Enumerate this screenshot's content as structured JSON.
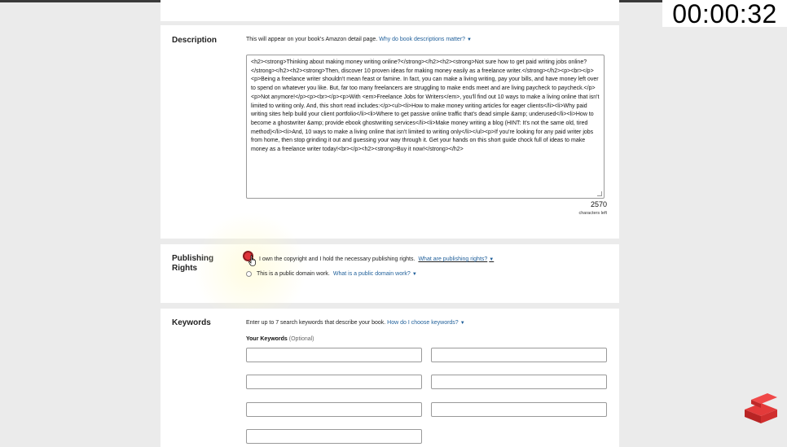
{
  "timer": "00:00:32",
  "description": {
    "title": "Description",
    "help_text": "This will appear on your book's Amazon detail page.",
    "help_link": "Why do book descriptions matter?",
    "content": "<h2><strong>Thinking about making money writing online?</strong></h2><h2><strong>Not sure how to get paid writing jobs online?</strong></h2><h2><strong>Then, discover 10 proven ideas for making money easily as a freelance writer.</strong></h2><p><br></p><p>Being a freelance writer shouldn't mean feast or famine. In fact, you can make a living writing, pay your bills, and have money left over to spend on whatever you like. But, far too many freelancers are struggling to make ends meet and are living paycheck to paycheck.</p><p>Not anymore!</p><p><br></p><p>With <em>Freelance Jobs for Writers</em>, you'll find out 10 ways to make a living online that isn't limited to writing only. And, this short read includes:</p><ul><li>How to make money writing articles for eager clients</li><li>Why paid writing sites help build your client portfolio</li><li>Where to get passive online traffic that's dead simple &amp; underused</li><li>How to become a ghostwriter &amp; provide ebook ghostwriting services</li><li>Make money writing a blog (HINT: It's not the same old, tired method)</li><li>And, 10 ways to make a living online that isn't limited to writing only</li></ul><p>If you're looking for any paid writer jobs from home, then stop grinding it out and guessing your way through it. Get your hands on this short guide chock full of ideas to make money as a freelance writer today!<br></p><h2><strong>Buy it now!</strong></h2>",
    "char_count": "2570",
    "char_count_label": "characters left"
  },
  "publishing": {
    "title_line1": "Publishing",
    "title_line2": "Rights",
    "option1_text": "I own the copyright and I hold the necessary publishing rights.",
    "option1_link": "What are publishing rights?",
    "option2_text": "This is a public domain work.",
    "option2_link": "What is a public domain work?",
    "selected": "option1"
  },
  "keywords": {
    "title": "Keywords",
    "help_text": "Enter up to 7 search keywords that describe your book.",
    "help_link": "How do I choose keywords?",
    "label": "Your Keywords",
    "label_optional": "(Optional)",
    "values": [
      "",
      "",
      "",
      "",
      "",
      "",
      ""
    ]
  },
  "icons": {
    "caret": "caret-down-icon",
    "logo": "red-stacked-logo-icon",
    "cursor": "hand-pointer-icon"
  },
  "colors": {
    "link": "#1f5f9a",
    "accent_red": "#e0343a",
    "page_bg": "#ebebeb"
  }
}
